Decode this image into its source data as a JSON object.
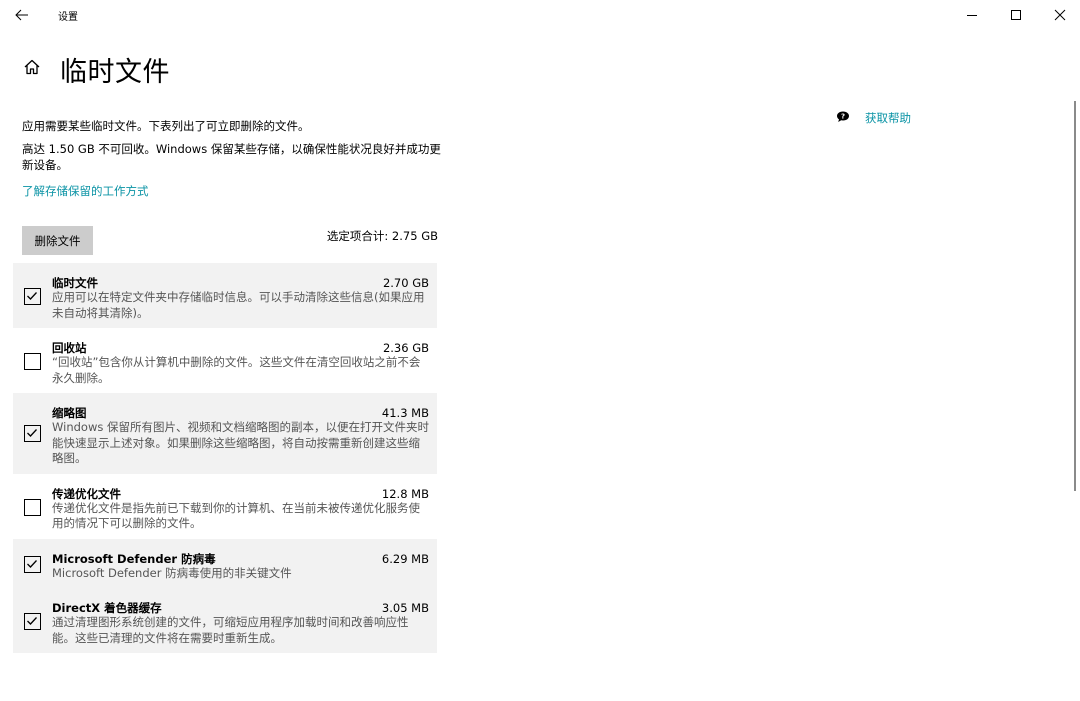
{
  "window": {
    "title": "设置"
  },
  "header": {
    "page_title": "临时文件"
  },
  "intro": {
    "line1": "应用需要某些临时文件。下表列出了可立即删除的文件。",
    "line2": "高达 1.50 GB 不可回收。Windows 保留某些存储，以确保性能状况良好并成功更新设备。",
    "learn_link": "了解存储保留的工作方式"
  },
  "actions": {
    "delete_label": "删除文件",
    "selected_total": "选定项合计: 2.75 GB"
  },
  "items": [
    {
      "name": "临时文件",
      "size": "2.70 GB",
      "checked": true,
      "desc": "应用可以在特定文件夹中存储临时信息。可以手动清除这些信息(如果应用未自动将其清除)。"
    },
    {
      "name": "回收站",
      "size": "2.36 GB",
      "checked": false,
      "desc": "“回收站”包含你从计算机中删除的文件。这些文件在清空回收站之前不会永久删除。"
    },
    {
      "name": "缩略图",
      "size": "41.3 MB",
      "checked": true,
      "desc": "Windows 保留所有图片、视频和文档缩略图的副本，以便在打开文件夹时能快速显示上述对象。如果删除这些缩略图，将自动按需重新创建这些缩略图。"
    },
    {
      "name": "传递优化文件",
      "size": "12.8 MB",
      "checked": false,
      "desc": "传递优化文件是指先前已下载到你的计算机、在当前未被传递优化服务使用的情况下可以删除的文件。"
    },
    {
      "name": "Microsoft Defender 防病毒",
      "size": "6.29 MB",
      "checked": true,
      "desc": "Microsoft Defender 防病毒使用的非关键文件"
    },
    {
      "name": "DirectX 着色器缓存",
      "size": "3.05 MB",
      "checked": true,
      "desc": "通过清理图形系统创建的文件，可缩短应用程序加载时间和改善响应性能。这些已清理的文件将在需要时重新生成。"
    }
  ],
  "sidebar": {
    "help_label": "获取帮助"
  },
  "icons": {
    "back": "back-arrow-icon",
    "home": "home-icon",
    "help": "help-chat-icon",
    "checkbox_check": "checkmark-icon"
  }
}
